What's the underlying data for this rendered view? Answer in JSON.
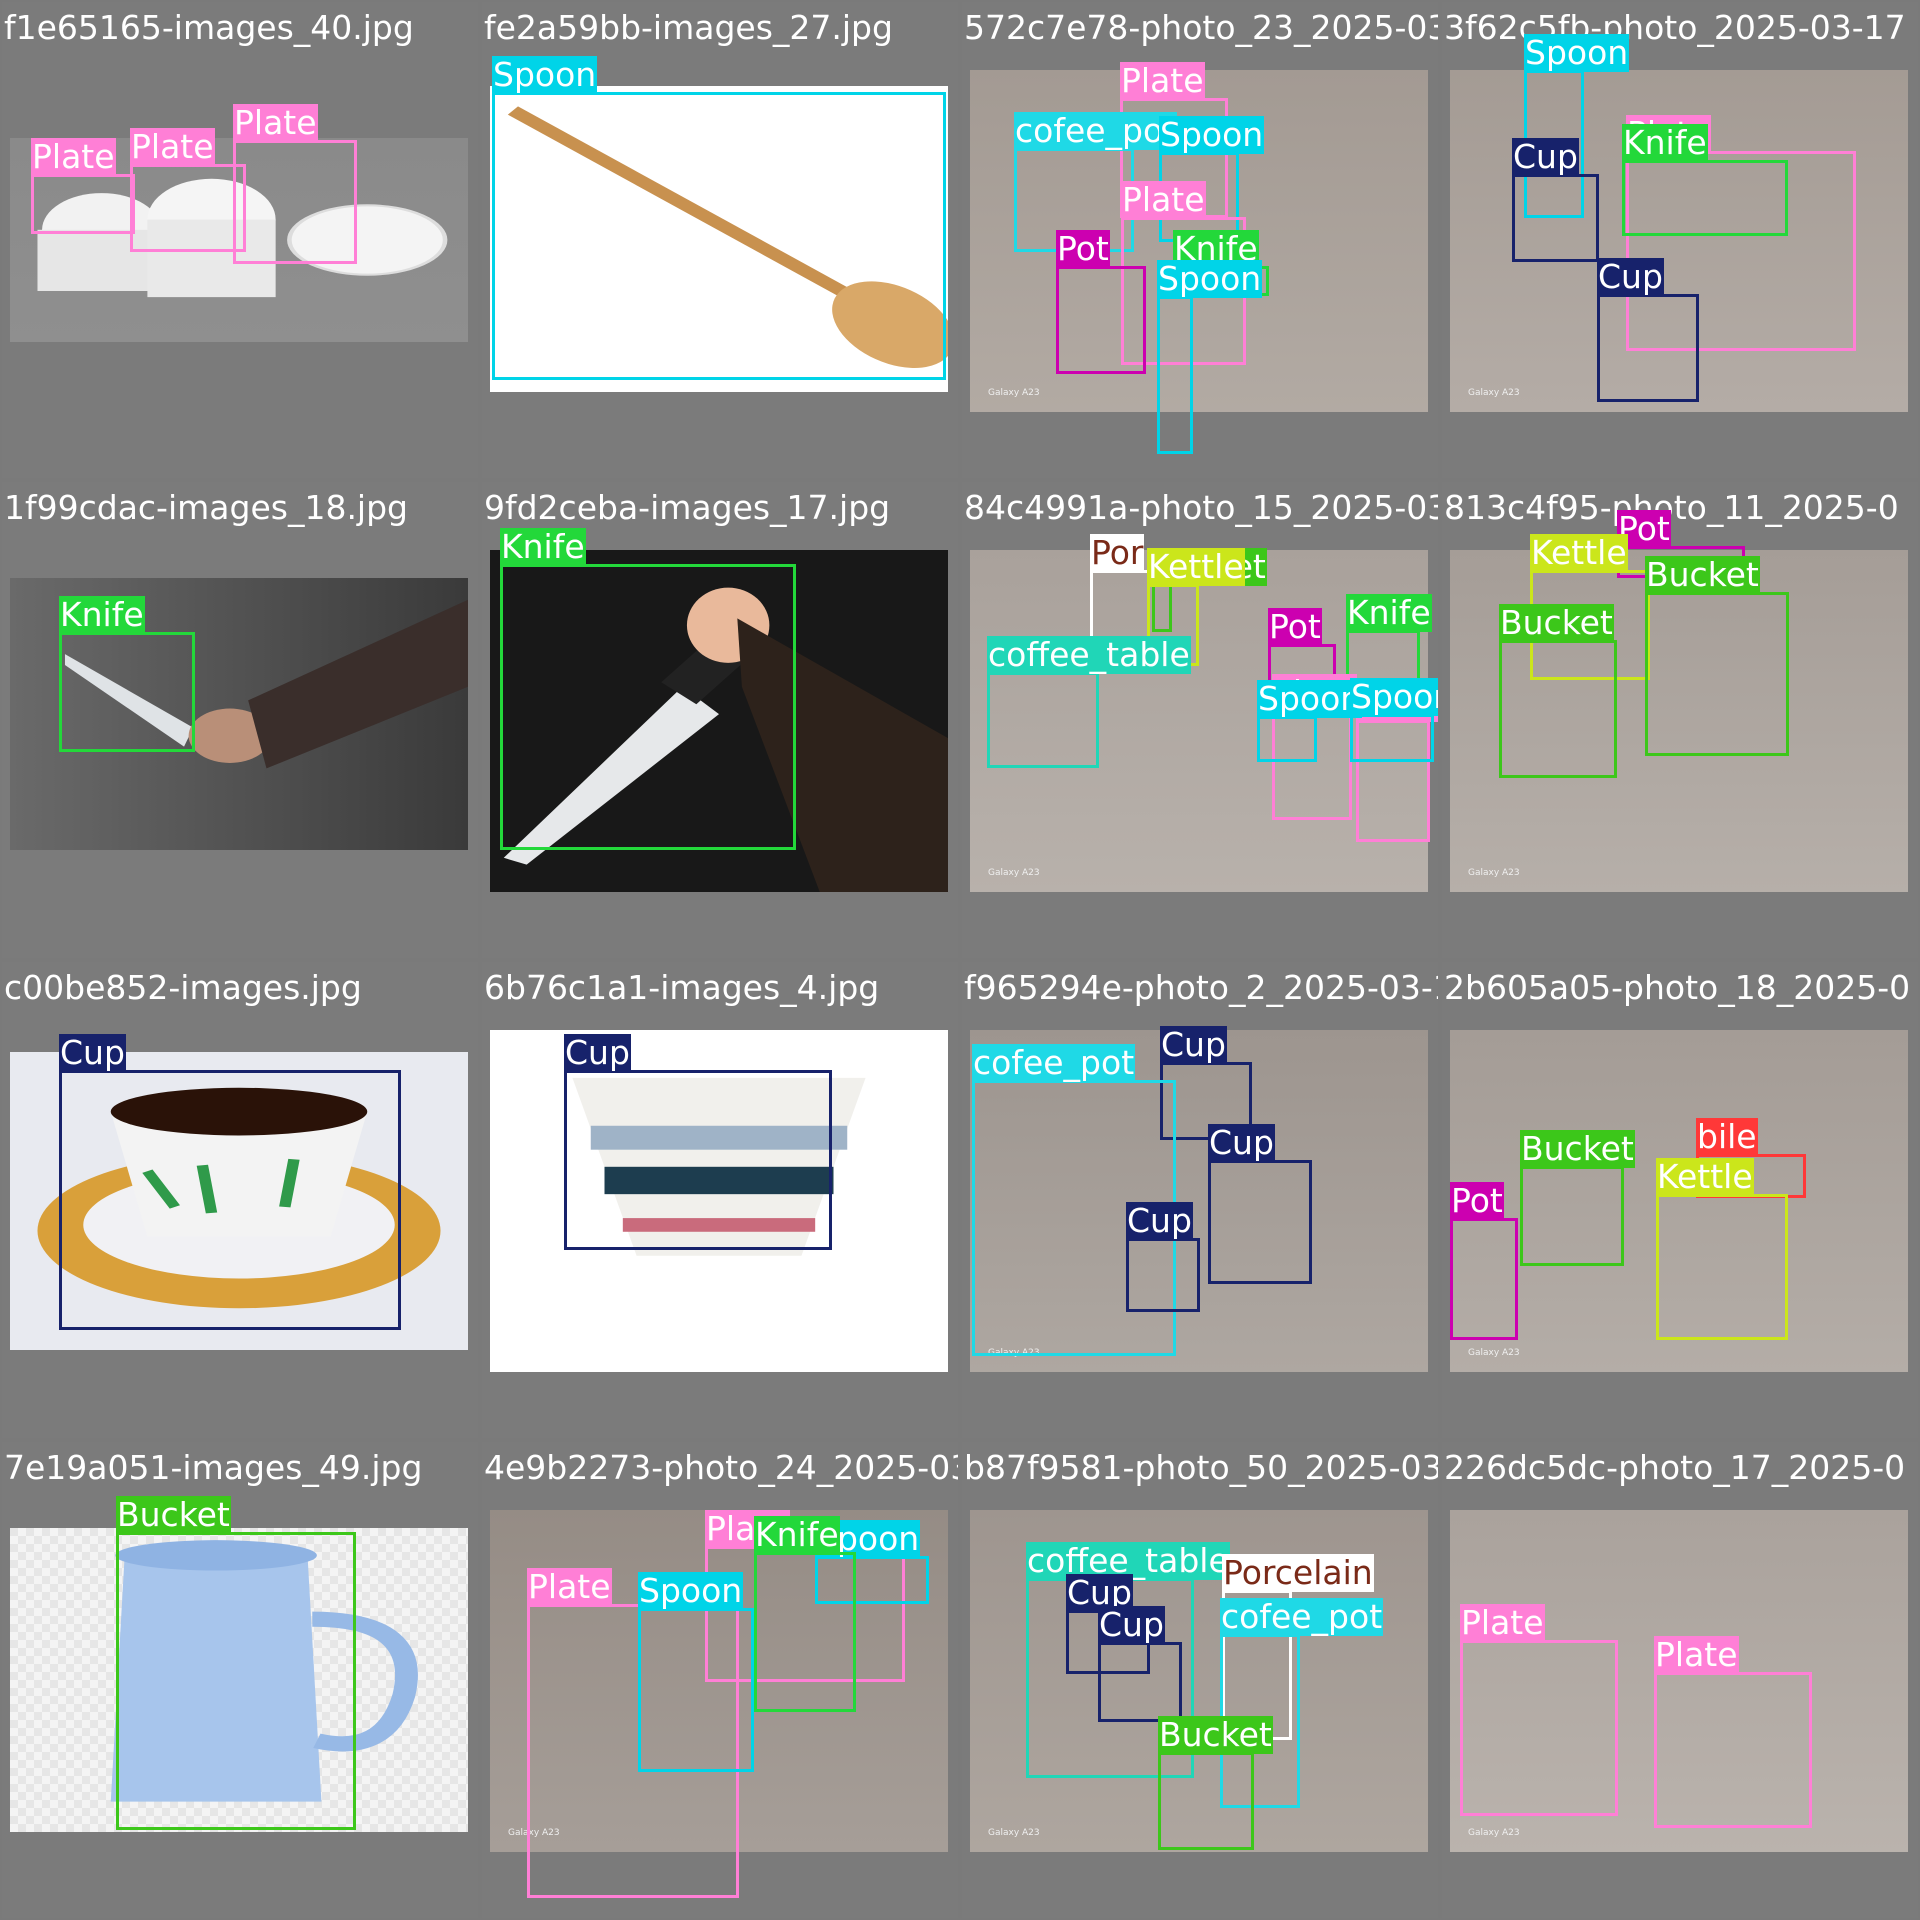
{
  "class_colors": {
    "Plate": "#ff7fd6",
    "Spoon": "#00d4e8",
    "Knife": "#23d83a",
    "Cup": "#17226b",
    "Pot": "#cc00b0",
    "cofee_pot": "#1fd9e6",
    "coffee_table": "#20d6b7",
    "Bucket": "#3cc71a",
    "Kettle": "#cbe61b",
    "Porcelain": "#ffffff",
    "Mobile": "#ff3838"
  },
  "tiles": [
    {
      "filename": "f1e65165-images_40.jpg",
      "labels": [
        {
          "cls": "Plate",
          "text": "Plate"
        },
        {
          "cls": "Plate",
          "text": "Plate"
        },
        {
          "cls": "Plate",
          "text": "Plate"
        }
      ]
    },
    {
      "filename": "fe2a59bb-images_27.jpg",
      "labels": [
        {
          "cls": "Spoon",
          "text": "Spoon"
        }
      ]
    },
    {
      "filename": "572c7e78-photo_23_2025-03-17_15-13-33.jpg",
      "labels": [
        {
          "cls": "Plate",
          "text": "Plate"
        },
        {
          "cls": "cofee_pot",
          "text": "cofee_pot"
        },
        {
          "cls": "Spoon",
          "text": "Spoon"
        },
        {
          "cls": "Plate",
          "text": "Plate"
        },
        {
          "cls": "Pot",
          "text": "Pot"
        },
        {
          "cls": "Knife",
          "text": "Knife"
        },
        {
          "cls": "Spoon",
          "text": "Spoon"
        }
      ]
    },
    {
      "filename": "3f62c5fb-photo_2025-03-17",
      "labels": [
        {
          "cls": "Spoon",
          "text": "Spoon"
        },
        {
          "cls": "Cup",
          "text": "Cup"
        },
        {
          "cls": "Plate",
          "text": "Plate"
        },
        {
          "cls": "Knife",
          "text": "Knife"
        },
        {
          "cls": "Cup",
          "text": "Cup"
        }
      ]
    },
    {
      "filename": "1f99cdac-images_18.jpg",
      "labels": [
        {
          "cls": "Knife",
          "text": "Knife"
        }
      ]
    },
    {
      "filename": "9fd2ceba-images_17.jpg",
      "labels": [
        {
          "cls": "Knife",
          "text": "Knife"
        }
      ]
    },
    {
      "filename": "84c4991a-photo_15_2025-03-17_15-13-33.jpg",
      "labels": [
        {
          "cls": "Porcelain",
          "text": "Por"
        },
        {
          "cls": "Bucket",
          "text": "Bucket"
        },
        {
          "cls": "Kettle",
          "text": "Kettle"
        },
        {
          "cls": "coffee_table",
          "text": "coffee_table"
        },
        {
          "cls": "Pot",
          "text": "Pot"
        },
        {
          "cls": "Knife",
          "text": "Knife"
        },
        {
          "cls": "Plate",
          "text": "Plate"
        },
        {
          "cls": "Plate",
          "text": "Plate"
        },
        {
          "cls": "Spoon",
          "text": "Spoon"
        },
        {
          "cls": "Spoon",
          "text": "Spoon"
        }
      ]
    },
    {
      "filename": "813c4f95-photo_11_2025-0",
      "labels": [
        {
          "cls": "Pot",
          "text": "Pot"
        },
        {
          "cls": "Kettle",
          "text": "Kettle"
        },
        {
          "cls": "Bucket",
          "text": "Bucket"
        },
        {
          "cls": "Bucket",
          "text": "Bucket"
        }
      ]
    },
    {
      "filename": "c00be852-images.jpg",
      "labels": [
        {
          "cls": "Cup",
          "text": "Cup"
        }
      ]
    },
    {
      "filename": "6b76c1a1-images_4.jpg",
      "labels": [
        {
          "cls": "Cup",
          "text": "Cup"
        }
      ]
    },
    {
      "filename": "f965294e-photo_2_2025-03-17_15-13-33.jpg",
      "labels": [
        {
          "cls": "Cup",
          "text": "Cup"
        },
        {
          "cls": "cofee_pot",
          "text": "cofee_pot"
        },
        {
          "cls": "Cup",
          "text": "Cup"
        },
        {
          "cls": "Cup",
          "text": "Cup"
        }
      ]
    },
    {
      "filename": "2b605a05-photo_18_2025-0",
      "labels": [
        {
          "cls": "Mobile",
          "text": "bile"
        },
        {
          "cls": "Bucket",
          "text": "Bucket"
        },
        {
          "cls": "Kettle",
          "text": "Kettle"
        },
        {
          "cls": "Pot",
          "text": "Pot"
        }
      ]
    },
    {
      "filename": "7e19a051-images_49.jpg",
      "labels": [
        {
          "cls": "Bucket",
          "text": "Bucket"
        }
      ]
    },
    {
      "filename": "4e9b2273-photo_24_2025-03-17_15-13-33.jpg",
      "labels": [
        {
          "cls": "Plate",
          "text": "Plate"
        },
        {
          "cls": "Spoon",
          "text": "Spoon"
        },
        {
          "cls": "Knife",
          "text": "Knife"
        },
        {
          "cls": "Plate",
          "text": "Plate"
        },
        {
          "cls": "Spoon",
          "text": "Spoon"
        }
      ]
    },
    {
      "filename": "b87f9581-photo_50_2025-03-17_15-13-33.jpg",
      "labels": [
        {
          "cls": "coffee_table",
          "text": "coffee_table"
        },
        {
          "cls": "Cup",
          "text": "Cup"
        },
        {
          "cls": "Porcelain",
          "text": "Porcelain"
        },
        {
          "cls": "Cup",
          "text": "Cup"
        },
        {
          "cls": "cofee_pot",
          "text": "cofee_pot"
        },
        {
          "cls": "Bucket",
          "text": "Bucket"
        }
      ]
    },
    {
      "filename": "226dc5dc-photo_17_2025-0",
      "labels": [
        {
          "cls": "Plate",
          "text": "Plate"
        },
        {
          "cls": "Plate",
          "text": "Plate"
        }
      ]
    }
  ],
  "watermark": "Galaxy A23"
}
